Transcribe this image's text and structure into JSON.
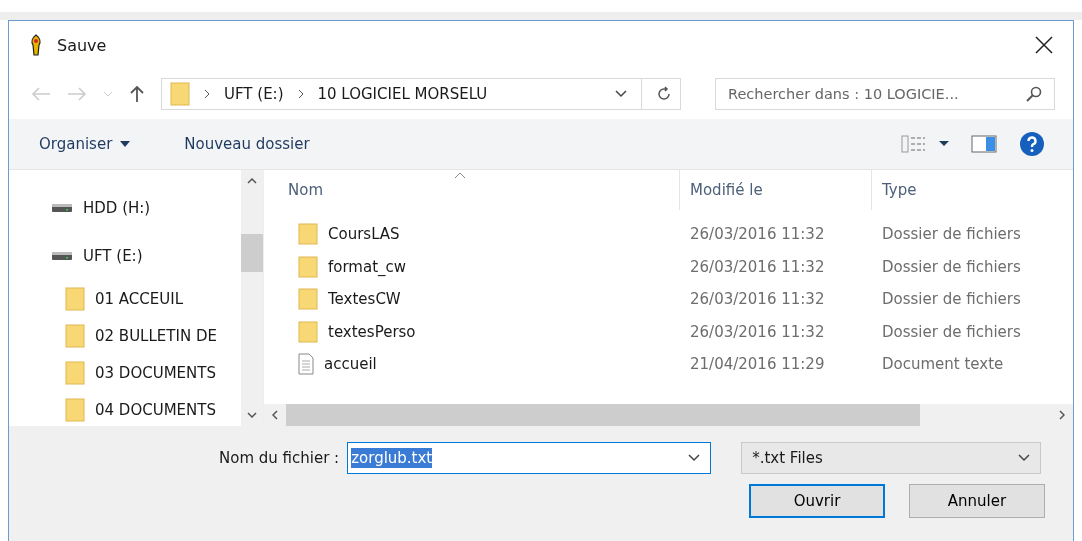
{
  "window": {
    "title": "Sauve"
  },
  "address": {
    "path": [
      "UFT (E:)",
      "10 LOGICIEL MORSELU"
    ]
  },
  "search": {
    "placeholder": "Rechercher dans : 10 LOGICIE..."
  },
  "toolbar": {
    "organize": "Organiser",
    "new_folder": "Nouveau dossier"
  },
  "sidebar": {
    "items": [
      {
        "label": "HDD (H:)",
        "kind": "drive"
      },
      {
        "label": "UFT (E:)",
        "kind": "drive"
      },
      {
        "label": "01 ACCEUIL",
        "kind": "folder"
      },
      {
        "label": "02 BULLETIN DE",
        "kind": "folder"
      },
      {
        "label": "03 DOCUMENTS",
        "kind": "folder"
      },
      {
        "label": "04 DOCUMENTS",
        "kind": "folder"
      }
    ]
  },
  "table": {
    "columns": [
      "Nom",
      "Modifié le",
      "Type"
    ],
    "rows": [
      {
        "name": "CoursLAS",
        "modified": "26/03/2016 11:32",
        "type": "Dossier de fichiers",
        "kind": "folder"
      },
      {
        "name": "format_cw",
        "modified": "26/03/2016 11:32",
        "type": "Dossier de fichiers",
        "kind": "folder"
      },
      {
        "name": "TextesCW",
        "modified": "26/03/2016 11:32",
        "type": "Dossier de fichiers",
        "kind": "folder"
      },
      {
        "name": "textesPerso",
        "modified": "26/03/2016 11:32",
        "type": "Dossier de fichiers",
        "kind": "folder"
      },
      {
        "name": "accueil",
        "modified": "21/04/2016 11:29",
        "type": "Document texte",
        "kind": "file"
      }
    ]
  },
  "filename": {
    "label": "Nom du fichier :",
    "value": "zorglub.txt",
    "text_selected": true
  },
  "filetype": {
    "value": "*.txt Files"
  },
  "buttons": [
    {
      "label": "Ouvrir",
      "default": true
    },
    {
      "label": "Annuler",
      "default": false
    }
  ]
}
